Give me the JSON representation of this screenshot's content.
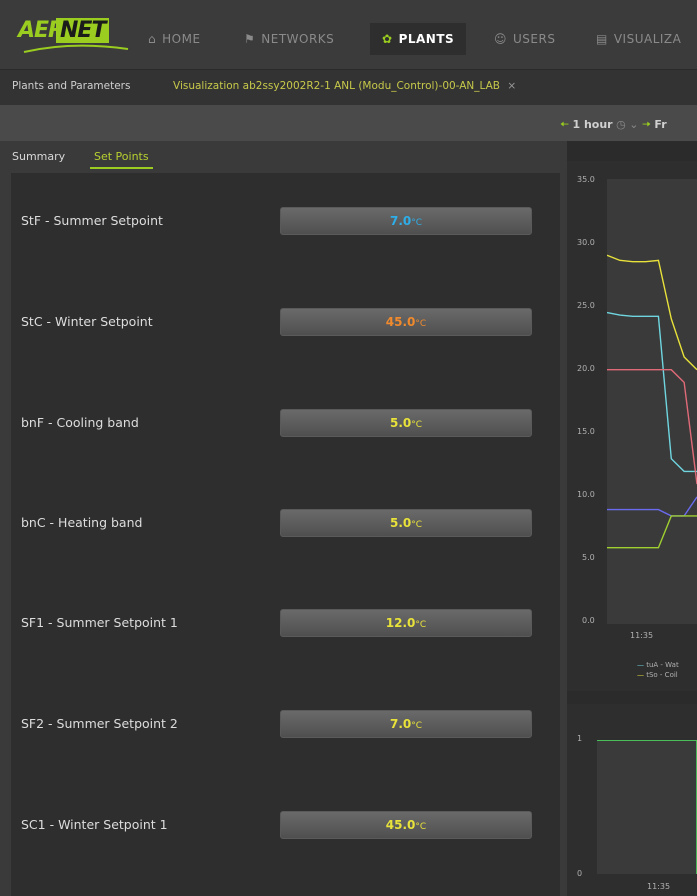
{
  "brand": {
    "logo_text_a": "AER",
    "logo_text_b": "NET"
  },
  "nav": [
    {
      "label": "HOME",
      "icon": "home-icon"
    },
    {
      "label": "NETWORKS",
      "icon": "sitemap-icon"
    },
    {
      "label": "PLANTS",
      "icon": "plant-icon",
      "active": true
    },
    {
      "label": "USERS",
      "icon": "users-icon"
    },
    {
      "label": "VISUALIZA",
      "icon": "chart-icon"
    }
  ],
  "tabs": [
    {
      "label": "Plants and Parameters"
    },
    {
      "label": "Visualization ab2ssy2002R2-1 ANL (Modu_Control)-00-AN_LAB"
    }
  ],
  "toolbar": {
    "period": "1 hour",
    "next_label": "Fr"
  },
  "subtabs": [
    "Summary",
    "Set Points"
  ],
  "params": [
    {
      "label": "StF - Summer Setpoint",
      "value": "7.0",
      "unit": "°C",
      "color": "#2eaee8"
    },
    {
      "label": "StC - Winter Setpoint",
      "value": "45.0",
      "unit": "°C",
      "color": "#f08a2c"
    },
    {
      "label": "bnF - Cooling band",
      "value": "5.0",
      "unit": "°C",
      "color": "#e8e23a"
    },
    {
      "label": "bnC - Heating band",
      "value": "5.0",
      "unit": "°C",
      "color": "#e8e23a"
    },
    {
      "label": "SF1 - Summer Setpoint 1",
      "value": "12.0",
      "unit": "°C",
      "color": "#e8e23a"
    },
    {
      "label": "SF2 - Summer Setpoint 2",
      "value": "7.0",
      "unit": "°C",
      "color": "#e8e23a"
    },
    {
      "label": "SC1 - Winter Setpoint 1",
      "value": "45.0",
      "unit": "°C",
      "color": "#e8e23a"
    }
  ],
  "chart_data": [
    {
      "type": "line",
      "ylim": [
        0,
        35
      ],
      "yticks": [
        "35.0",
        "30.0",
        "25.0",
        "20.0",
        "15.0",
        "10.0",
        "5.0",
        "0.0"
      ],
      "xticks": [
        "11:35"
      ],
      "legend": [
        "tuA - Wat",
        "tSo - Coil"
      ],
      "series": [
        {
          "color": "#e8e23a",
          "values": [
            29,
            28.6,
            28.5,
            28.5,
            28.6,
            24,
            21,
            20
          ]
        },
        {
          "color": "#6fd6e0",
          "values": [
            24.5,
            24.3,
            24.2,
            24.2,
            24.2,
            13,
            12,
            12
          ]
        },
        {
          "color": "#e06a78",
          "values": [
            20,
            20,
            20,
            20,
            20,
            20,
            19,
            11
          ]
        },
        {
          "color": "#6a6aee",
          "values": [
            9,
            9,
            9,
            9,
            9,
            8.5,
            8.5,
            10
          ]
        },
        {
          "color": "#a0d030",
          "values": [
            6,
            6,
            6,
            6,
            6,
            8.5,
            8.5,
            8.5
          ]
        }
      ]
    },
    {
      "type": "line",
      "ylim": [
        0,
        1
      ],
      "yticks": [
        "1",
        "0"
      ],
      "xticks": [
        "11:35"
      ],
      "series": [
        {
          "color": "#6fd6e0",
          "values": [
            1,
            1,
            1,
            1,
            0
          ]
        },
        {
          "color": "#46d046",
          "values": [
            1,
            1,
            1,
            1,
            1,
            0
          ]
        }
      ]
    }
  ]
}
